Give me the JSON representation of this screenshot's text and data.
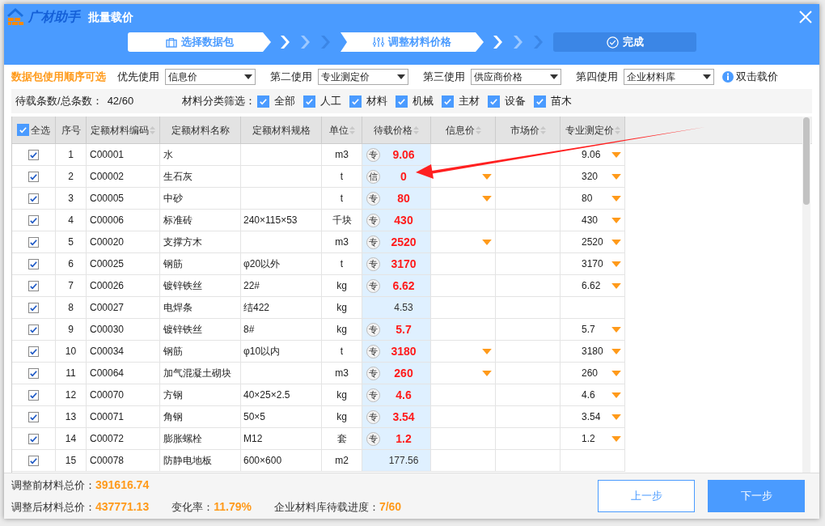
{
  "window": {
    "brand": "广材助手",
    "title": "批量载价"
  },
  "steps": [
    {
      "label": "选择数据包",
      "reached": true
    },
    {
      "label": "调整材料价格",
      "reached": true
    },
    {
      "label": "完成",
      "reached": false
    }
  ],
  "priority": {
    "label": "数据包使用顺序可选",
    "selects": [
      {
        "label": "优先使用",
        "value": "信息价"
      },
      {
        "label": "第二使用",
        "value": "专业测定价"
      },
      {
        "label": "第三使用",
        "value": "供应商价格"
      },
      {
        "label": "第四使用",
        "value": "企业材料库"
      }
    ],
    "hint": "双击载价"
  },
  "filter_row": {
    "count_label": "待载条数/总条数：",
    "count": "42/60",
    "filter_label": "材料分类筛选：",
    "filters": [
      {
        "label": "全部",
        "checked": true
      },
      {
        "label": "人工",
        "checked": true
      },
      {
        "label": "材料",
        "checked": true
      },
      {
        "label": "机械",
        "checked": true
      },
      {
        "label": "主材",
        "checked": true
      },
      {
        "label": "设备",
        "checked": true
      },
      {
        "label": "苗木",
        "checked": true
      }
    ]
  },
  "table": {
    "select_all": {
      "label": "全选",
      "checked": true
    },
    "columns": [
      {
        "label": "序号",
        "sortable": false
      },
      {
        "label": "定额材料编码",
        "sortable": true
      },
      {
        "label": "定额材料名称",
        "sortable": false
      },
      {
        "label": "定额材料规格",
        "sortable": false
      },
      {
        "label": "单位",
        "sortable": true
      },
      {
        "label": "待载价格",
        "sortable": true
      },
      {
        "label": "信息价",
        "sortable": true
      },
      {
        "label": "市场价",
        "sortable": true
      },
      {
        "label": "专业测定价",
        "sortable": true
      }
    ],
    "rows": [
      {
        "checked": true,
        "no": "1",
        "code": "C00001",
        "name": "水",
        "unit": "m3",
        "tag": "专",
        "price": "9.06",
        "adjusted": true,
        "info_options": false,
        "pro": "9.06",
        "pro_options": true
      },
      {
        "checked": true,
        "no": "2",
        "code": "C00002",
        "name": "生石灰",
        "unit": "t",
        "tag": "信",
        "price": "0",
        "adjusted": true,
        "info_options": true,
        "pro": "320",
        "pro_options": true
      },
      {
        "checked": true,
        "no": "3",
        "code": "C00005",
        "name": "中砂",
        "unit": "t",
        "tag": "专",
        "price": "80",
        "adjusted": true,
        "info_options": true,
        "pro": "80",
        "pro_options": true
      },
      {
        "checked": true,
        "no": "4",
        "code": "C00006",
        "name": "标准砖",
        "spec": "240×115×53",
        "unit": "千块",
        "tag": "专",
        "price": "430",
        "adjusted": true,
        "info_options": false,
        "pro": "430",
        "pro_options": true
      },
      {
        "checked": true,
        "no": "5",
        "code": "C00020",
        "name": "支撑方木",
        "unit": "m3",
        "tag": "专",
        "price": "2520",
        "adjusted": true,
        "info_options": true,
        "pro": "2520",
        "pro_options": true
      },
      {
        "checked": true,
        "no": "6",
        "code": "C00025",
        "name": "钢筋",
        "spec": "φ20以外",
        "unit": "t",
        "tag": "专",
        "price": "3170",
        "adjusted": true,
        "info_options": false,
        "pro": "3170",
        "pro_options": true
      },
      {
        "checked": true,
        "no": "7",
        "code": "C00026",
        "name": "镀锌铁丝",
        "spec": "22#",
        "unit": "kg",
        "tag": "专",
        "price": "6.62",
        "adjusted": true,
        "info_options": false,
        "pro": "6.62",
        "pro_options": true
      },
      {
        "checked": true,
        "no": "8",
        "code": "C00027",
        "name": "电焊条",
        "spec": "结422",
        "unit": "kg",
        "price": "4.53",
        "adjusted": false,
        "info_options": false,
        "pro_options": false
      },
      {
        "checked": true,
        "no": "9",
        "code": "C00030",
        "name": "镀锌铁丝",
        "spec": "8#",
        "unit": "kg",
        "tag": "专",
        "price": "5.7",
        "adjusted": true,
        "info_options": false,
        "pro": "5.7",
        "pro_options": true
      },
      {
        "checked": true,
        "no": "10",
        "code": "C00034",
        "name": "钢筋",
        "spec": "φ10以内",
        "unit": "t",
        "tag": "专",
        "price": "3180",
        "adjusted": true,
        "info_options": true,
        "pro": "3180",
        "pro_options": true
      },
      {
        "checked": true,
        "no": "11",
        "code": "C00064",
        "name": "加气混凝土砌块",
        "unit": "m3",
        "tag": "专",
        "price": "260",
        "adjusted": true,
        "info_options": true,
        "pro": "260",
        "pro_options": true
      },
      {
        "checked": true,
        "no": "12",
        "code": "C00070",
        "name": "方钢",
        "spec": "40×25×2.5",
        "unit": "kg",
        "tag": "专",
        "price": "4.6",
        "adjusted": true,
        "info_options": false,
        "pro": "4.6",
        "pro_options": true
      },
      {
        "checked": true,
        "no": "13",
        "code": "C00071",
        "name": "角钢",
        "spec": "50×5",
        "unit": "kg",
        "tag": "专",
        "price": "3.54",
        "adjusted": true,
        "info_options": false,
        "pro": "3.54",
        "pro_options": true
      },
      {
        "checked": true,
        "no": "14",
        "code": "C00072",
        "name": "膨胀螺栓",
        "spec": "M12",
        "unit": "套",
        "tag": "专",
        "price": "1.2",
        "adjusted": true,
        "info_options": false,
        "pro": "1.2",
        "pro_options": true
      },
      {
        "checked": true,
        "no": "15",
        "code": "C00078",
        "name": "防静电地板",
        "spec": "600×600",
        "unit": "m2",
        "price": "177.56",
        "adjusted": false,
        "info_options": false,
        "pro_options": false
      }
    ]
  },
  "summary": [
    {
      "label": "调整前材料总价：",
      "value": "391616.74"
    },
    {
      "label": "调整后材料总价：",
      "value": "437771.13"
    },
    {
      "label": "变化率：",
      "value": "11.79%"
    },
    {
      "label": "企业材料库待载进度：",
      "value": "7/60"
    }
  ],
  "buttons": [
    {
      "label": "上一步",
      "kind": "secondary"
    },
    {
      "label": "下一步",
      "kind": "primary"
    }
  ]
}
